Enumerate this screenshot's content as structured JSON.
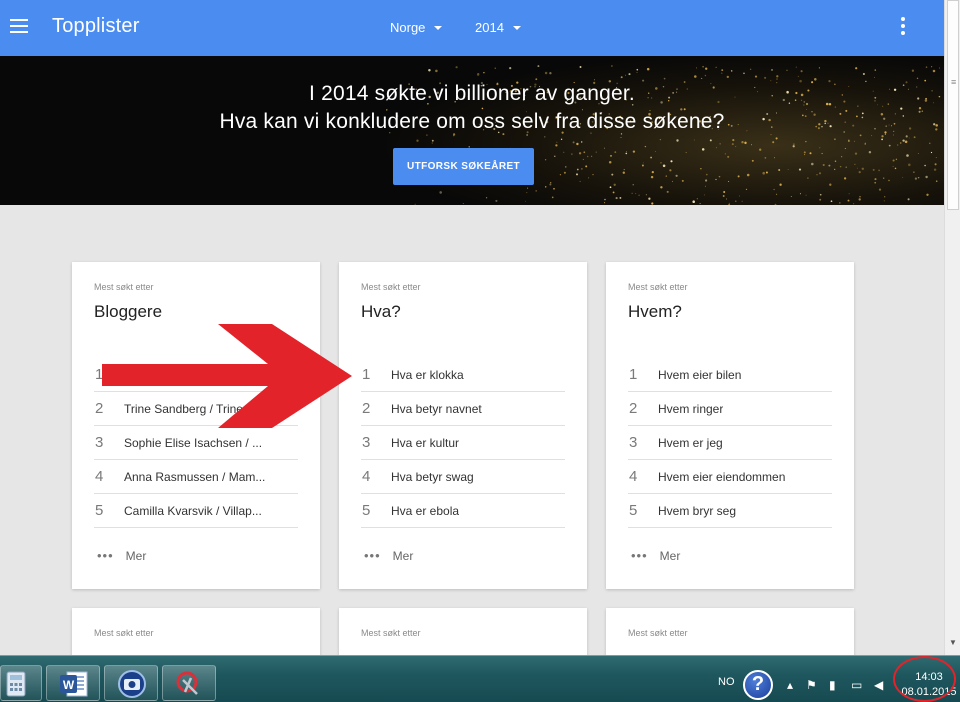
{
  "app": {
    "title": "Topplister",
    "country": "Norge",
    "year": "2014",
    "accent_color": "#4b8cf1"
  },
  "hero": {
    "line1": "I 2014 søkte vi billioner av ganger.",
    "line2": "Hva kan vi konkludere om oss selv fra disse søkene?",
    "button": "UTFORSK SØKEÅRET"
  },
  "cards": [
    {
      "eyebrow": "Mest søkt etter",
      "title": "Bloggere",
      "items": [
        {
          "rank": "1",
          "text": ""
        },
        {
          "rank": "2",
          "text": "Trine Sandberg / Trines..."
        },
        {
          "rank": "3",
          "text": "Sophie Elise Isachsen / ..."
        },
        {
          "rank": "4",
          "text": "Anna Rasmussen / Mam..."
        },
        {
          "rank": "5",
          "text": "Camilla Kvarsvik / Villap..."
        }
      ],
      "more": "Mer"
    },
    {
      "eyebrow": "Mest søkt etter",
      "title": "Hva?",
      "items": [
        {
          "rank": "1",
          "text": "Hva er klokka"
        },
        {
          "rank": "2",
          "text": "Hva betyr navnet"
        },
        {
          "rank": "3",
          "text": "Hva er kultur"
        },
        {
          "rank": "4",
          "text": "Hva betyr swag"
        },
        {
          "rank": "5",
          "text": "Hva er ebola"
        }
      ],
      "more": "Mer"
    },
    {
      "eyebrow": "Mest søkt etter",
      "title": "Hvem?",
      "items": [
        {
          "rank": "1",
          "text": "Hvem eier bilen"
        },
        {
          "rank": "2",
          "text": "Hvem ringer"
        },
        {
          "rank": "3",
          "text": "Hvem er jeg"
        },
        {
          "rank": "4",
          "text": "Hvem eier eiendommen"
        },
        {
          "rank": "5",
          "text": "Hvem bryr seg"
        }
      ],
      "more": "Mer"
    }
  ],
  "lower_cards": [
    {
      "eyebrow": "Mest søkt etter"
    },
    {
      "eyebrow": "Mest søkt etter"
    },
    {
      "eyebrow": "Mest søkt etter"
    }
  ],
  "taskbar": {
    "language": "NO",
    "time": "14:03",
    "date": "08.01.2015",
    "apps": [
      "calculator-icon",
      "word-icon",
      "camera-icon",
      "snipping-tool-icon"
    ],
    "tray": [
      "help-icon",
      "show-hidden-icons",
      "flag-icon",
      "power-icon",
      "network-icon",
      "volume-icon"
    ]
  },
  "annotations": {
    "arrow_color": "#e2232a",
    "circle_color": "#e2232a"
  }
}
